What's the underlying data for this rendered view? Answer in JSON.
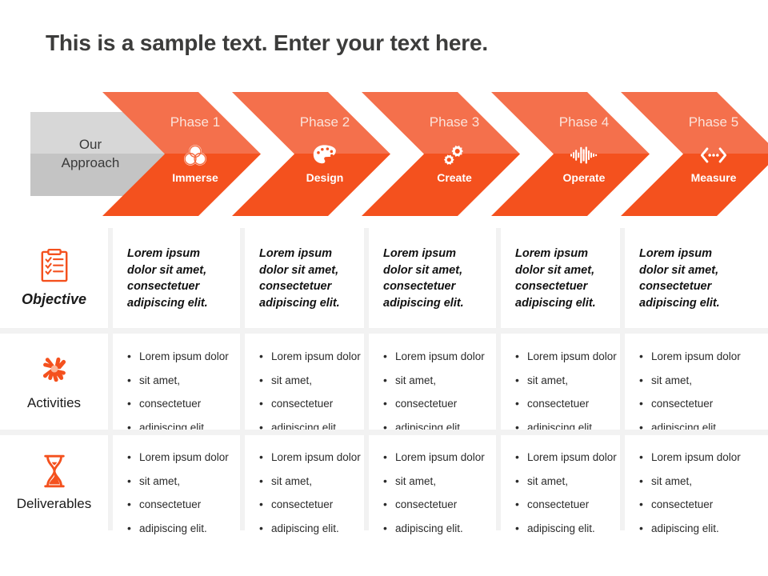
{
  "slide": {
    "title": "This is a sample text. Enter your text here."
  },
  "process": {
    "approach_label_line1": "Our",
    "approach_label_line2": "Approach",
    "colors": {
      "orange_light": "#f4704c",
      "orange_dark": "#f4511e",
      "grey_light": "#d7d7d7",
      "grey_dark": "#c4c4c4",
      "title_text": "#3c3c3b"
    },
    "phases": [
      {
        "phase": "Phase 1",
        "label": "Immerse",
        "icon": "venn-circles-icon"
      },
      {
        "phase": "Phase 2",
        "label": "Design",
        "icon": "palette-icon"
      },
      {
        "phase": "Phase 3",
        "label": "Create",
        "icon": "gears-icon"
      },
      {
        "phase": "Phase 4",
        "label": "Operate",
        "icon": "waveform-icon"
      },
      {
        "phase": "Phase 5",
        "label": "Measure",
        "icon": "code-brackets-icon"
      }
    ]
  },
  "matrix": {
    "categories": [
      {
        "label": "Objective",
        "icon": "checklist-icon"
      },
      {
        "label": "Activities",
        "icon": "teamwork-hands-icon"
      },
      {
        "label": "Deliverables",
        "icon": "hourglass-icon"
      }
    ],
    "objective_rows": [
      "Lorem ipsum dolor sit amet, consectetuer adipiscing elit.",
      "Lorem ipsum dolor sit amet, consectetuer adipiscing elit.",
      "Lorem ipsum dolor sit amet, consectetuer adipiscing elit.",
      "Lorem ipsum dolor sit amet, consectetuer adipiscing elit.",
      "Lorem ipsum dolor sit amet, consectetuer adipiscing elit."
    ],
    "activities_rows": [
      [
        "Lorem ipsum dolor",
        "sit amet,",
        "consectetuer",
        "adipiscing elit."
      ],
      [
        "Lorem ipsum dolor",
        "sit amet,",
        "consectetuer",
        "adipiscing elit."
      ],
      [
        "Lorem ipsum dolor",
        "sit amet,",
        "consectetuer",
        "adipiscing elit."
      ],
      [
        "Lorem ipsum dolor",
        "sit amet,",
        "consectetuer",
        "adipiscing elit."
      ],
      [
        "Lorem ipsum dolor",
        "sit amet,",
        "consectetuer",
        "adipiscing elit."
      ]
    ],
    "deliverables_rows": [
      [
        "Lorem ipsum dolor",
        "sit amet,",
        "consectetuer",
        "adipiscing elit."
      ],
      [
        "Lorem ipsum dolor",
        "sit amet,",
        "consectetuer",
        "adipiscing elit."
      ],
      [
        "Lorem ipsum dolor",
        "sit amet,",
        "consectetuer",
        "adipiscing elit."
      ],
      [
        "Lorem ipsum dolor",
        "sit amet,",
        "consectetuer",
        "adipiscing elit."
      ],
      [
        "Lorem ipsum dolor",
        "sit amet,",
        "consectetuer",
        "adipiscing elit."
      ]
    ]
  }
}
